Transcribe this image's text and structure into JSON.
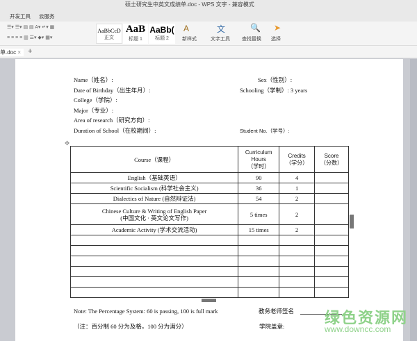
{
  "window": {
    "title": "硕士研究生中英文成绩单.doc - WPS 文字 - 兼容模式"
  },
  "menu": [
    "开发工具",
    "云服务"
  ],
  "toolbar": {
    "styles": [
      {
        "preview": "AaBbCcD",
        "label": "正文"
      },
      {
        "preview": "AaB",
        "label": "标题 1"
      },
      {
        "preview": "AaBb(",
        "label": "标题 2"
      }
    ],
    "new_style": "新样式",
    "text_tools": "文字工具",
    "find_replace": "查找替换",
    "select": "选择"
  },
  "tab": {
    "name": "单.doc",
    "close": "×",
    "add": "+"
  },
  "form": {
    "name": "Name（姓名）:",
    "sex": "Sex（性别）:",
    "dob": "Date of Birthday（出生年月）:",
    "schooling": "Schooling（学制）: 3 years",
    "college": "College（学院）:",
    "major": "Major（专业）:",
    "area": "Area of research（研究方向）:",
    "duration": "Duration of School（在校期间）:",
    "student_no": "Student No.（学号）:"
  },
  "table": {
    "headers": {
      "course": "Course（课程）",
      "hours": [
        "Curriculum",
        "Hours",
        "（学时）"
      ],
      "credits": [
        "Credits",
        "（学分）"
      ],
      "score": [
        "Score",
        "（分数）"
      ]
    },
    "rows": [
      {
        "course": "English（基础英语）",
        "hours": "90",
        "credits": "4",
        "score": ""
      },
      {
        "course": "Scientific Socialism (科学社会主义)",
        "hours": "36",
        "credits": "1",
        "score": ""
      },
      {
        "course": "Dialectics of Nature (自然辩证法)",
        "hours": "54",
        "credits": "2",
        "score": ""
      },
      {
        "course": "Chinese Culture & Writing of English Paper",
        "course2": "(中国文化 · 英文论文写作)",
        "hours": "5 times",
        "credits": "2",
        "score": ""
      },
      {
        "course": "Academic Activity (学术交流活动)",
        "hours": "15 times",
        "credits": "2",
        "score": ""
      }
    ]
  },
  "footer": {
    "note": "Note: The Percentage System: 60 is passing, 100 is full mark",
    "note_cn": "（注：百分制 60 分为及格，100 分为满分）",
    "signature": "教务老师签名",
    "seal": "学院盖章:"
  },
  "watermark": {
    "text": "绿色资源网",
    "url": "www.downcc.com"
  }
}
